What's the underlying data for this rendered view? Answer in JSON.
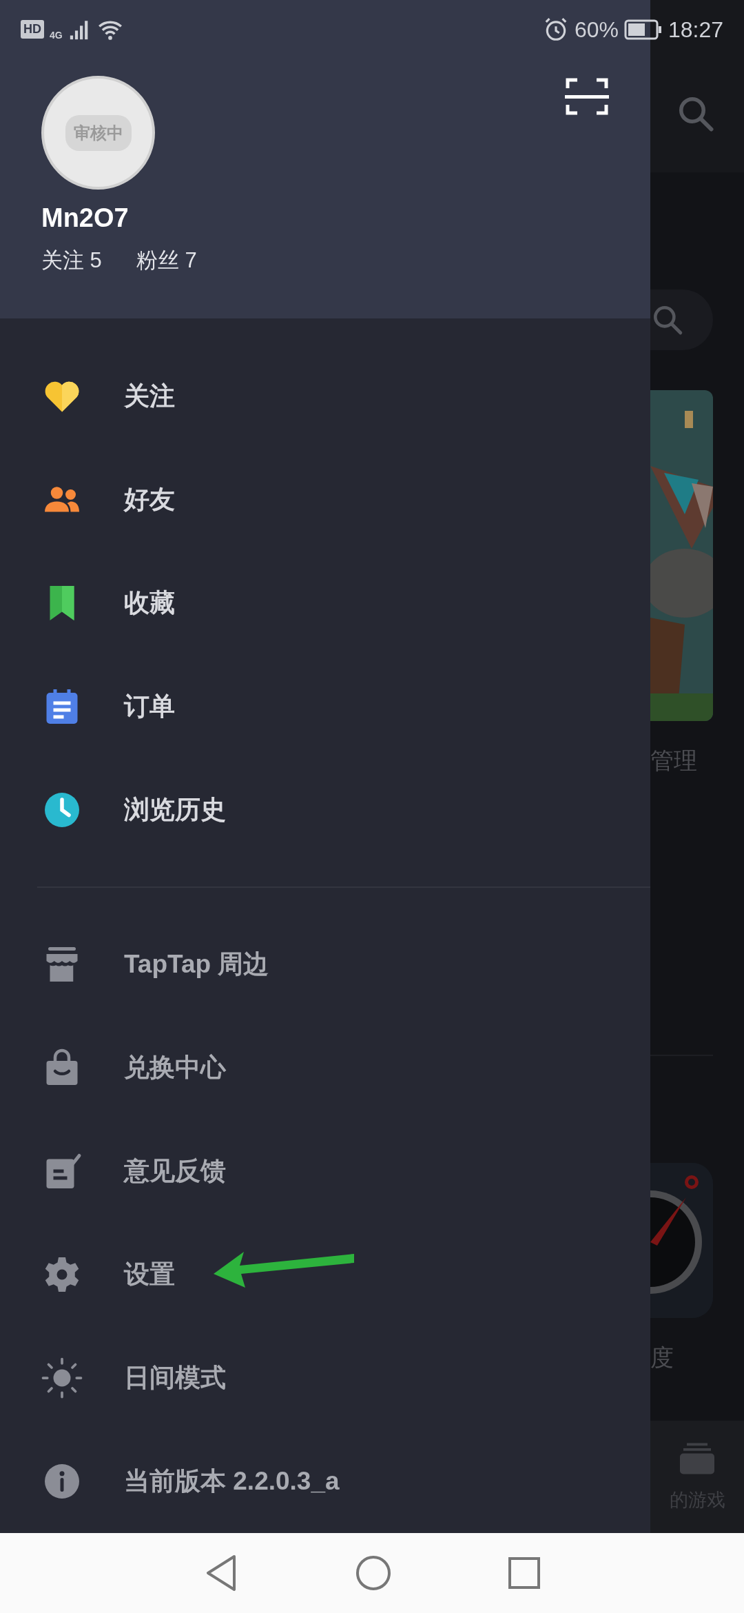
{
  "status_bar": {
    "hd": "HD",
    "network": "4G",
    "battery": "60%",
    "time": "18:27"
  },
  "profile": {
    "avatar_badge": "审核中",
    "name": "Mn2O7",
    "following": "关注 5",
    "followers": "粉丝 7"
  },
  "primary_items": [
    {
      "label": "关注"
    },
    {
      "label": "好友"
    },
    {
      "label": "收藏"
    },
    {
      "label": "订单"
    },
    {
      "label": "浏览历史"
    }
  ],
  "secondary_items": [
    {
      "label": "TapTap 周边"
    },
    {
      "label": "兑换中心"
    },
    {
      "label": "意见反馈"
    },
    {
      "label": "设置"
    },
    {
      "label": "日间模式"
    },
    {
      "label": "当前版本 2.2.0.3_a"
    }
  ],
  "background_app": {
    "section_action": "管理",
    "game_label": "度",
    "tab_label": "的游戏"
  }
}
